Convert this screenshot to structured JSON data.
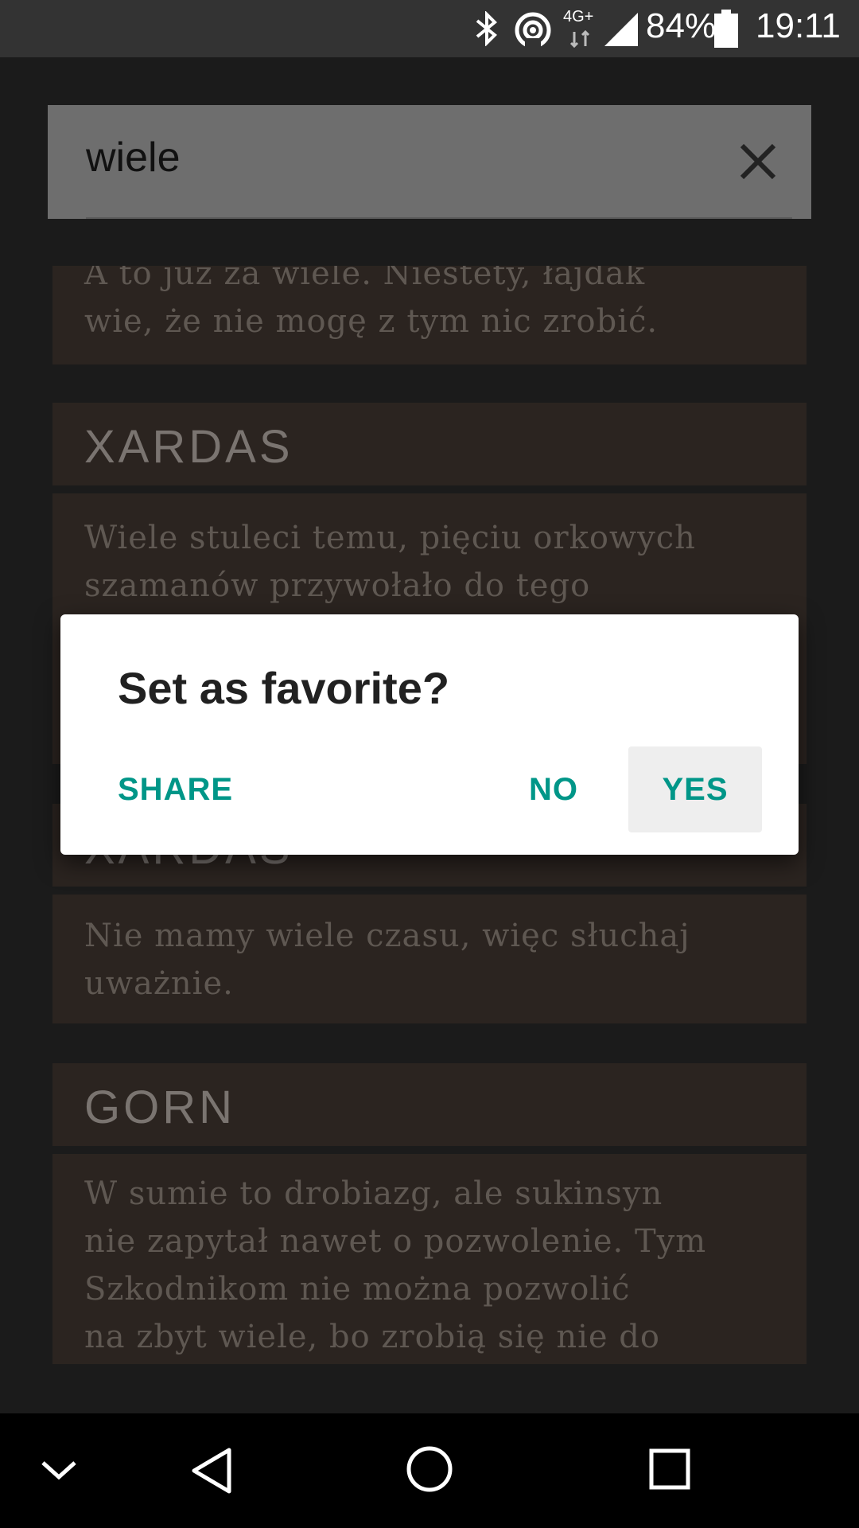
{
  "status_bar": {
    "network_label": "4G+",
    "battery": "84%",
    "time": "19:11",
    "icons": [
      "bluetooth-icon",
      "hotspot-icon",
      "network-icon",
      "signal-icon",
      "battery-icon"
    ]
  },
  "search": {
    "query": "wiele",
    "clear_icon": "close-icon"
  },
  "cards": [
    {
      "speaker": "",
      "quote_lines": [
        "A to już za wiele. Niestety, łajdak",
        "wie, że nie mogę z tym nic zrobić."
      ]
    },
    {
      "speaker": "XARDAS",
      "quote_lines": [
        "Wiele stuleci temu, pięciu orkowych",
        "szamanów przywołało do tego"
      ]
    },
    {
      "speaker": "XARDAS",
      "quote_lines": [
        "Nie mamy wiele czasu, więc słuchaj",
        "uważnie."
      ]
    },
    {
      "speaker": "GORN",
      "quote_lines": [
        "W sumie to drobiazg, ale sukinsyn",
        "nie zapytał nawet o pozwolenie. Tym",
        "Szkodnikom nie można pozwolić",
        "na zbyt wiele, bo zrobią się nie do"
      ]
    }
  ],
  "dialog": {
    "title": "Set as favorite?",
    "share_label": "SHARE",
    "no_label": "NO",
    "yes_label": "YES",
    "accent_color": "#009688"
  },
  "nav_bar": {
    "icons": [
      "chevron-down-icon",
      "back-icon",
      "home-icon",
      "recents-icon"
    ]
  }
}
